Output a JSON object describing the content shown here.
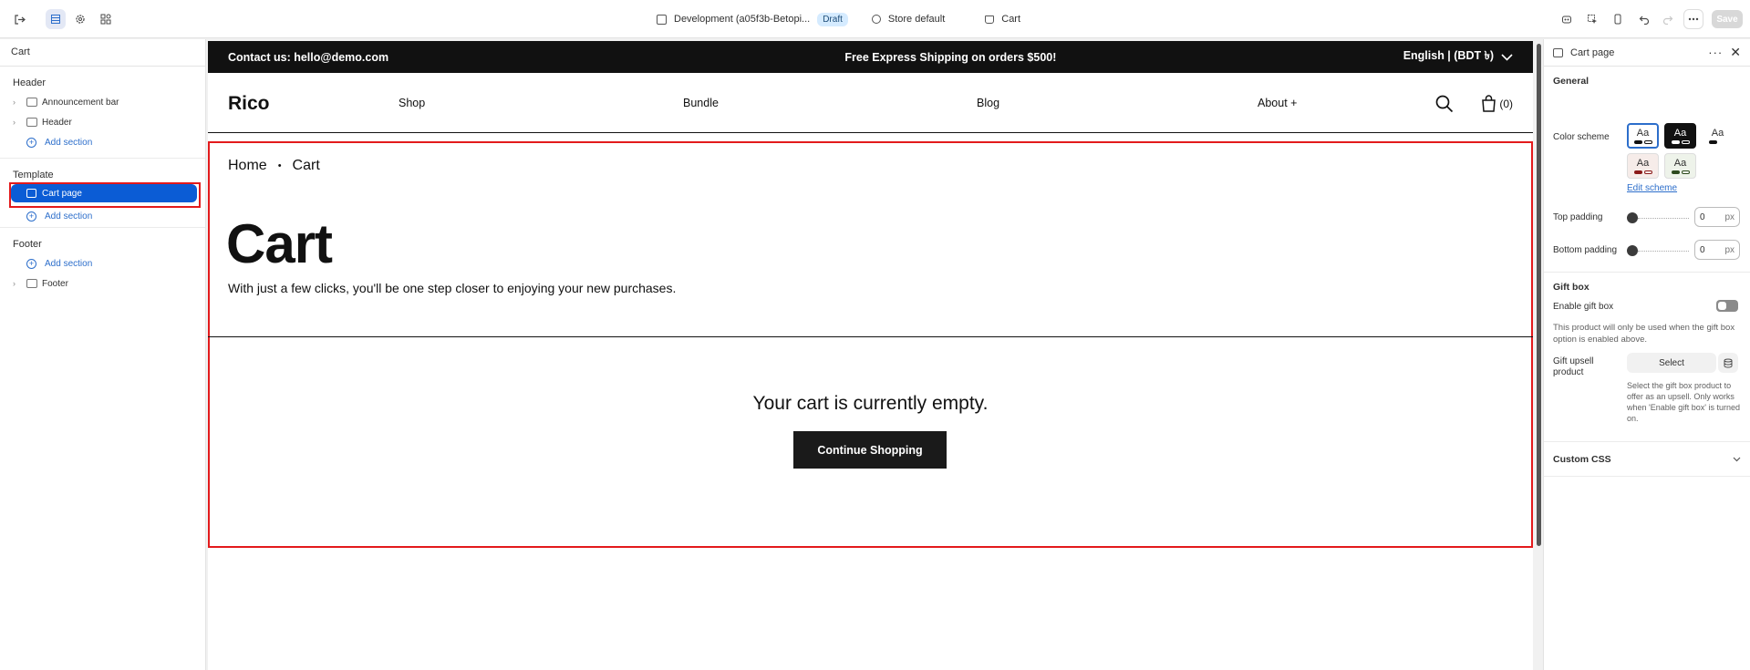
{
  "topbar": {
    "store_label": "Development (a05f3b-Betopi...",
    "draft_badge": "Draft",
    "theme_label": "Store default",
    "page_label": "Cart",
    "save_label": "Save"
  },
  "left_panel": {
    "title": "Cart",
    "header_group": "Header",
    "header_items": [
      "Announcement bar",
      "Header"
    ],
    "add_section": "Add section",
    "template_group": "Template",
    "template_selected": "Cart page",
    "footer_group": "Footer",
    "footer_items": [
      "Footer"
    ]
  },
  "preview": {
    "announce_left": "Contact us: hello@demo.com",
    "announce_center": "Free Express Shipping on orders $500!",
    "announce_right": "English | (BDT ৳)",
    "logo": "Rico",
    "nav": [
      "Shop",
      "Bundle",
      "Blog",
      "About +"
    ],
    "cart_count": "(0)",
    "crumb_home": "Home",
    "crumb_sep": "•",
    "crumb_current": "Cart",
    "heading": "Cart",
    "subheading": "With just a few clicks, you'll be one step closer to enjoying your new purchases.",
    "empty_message": "Your cart is currently empty.",
    "continue_button": "Continue Shopping"
  },
  "right_panel": {
    "title": "Cart page",
    "general": "General",
    "color_scheme_label": "Color scheme",
    "swatch_text": "Aa",
    "edit_scheme": "Edit scheme",
    "top_padding_label": "Top padding",
    "top_padding_value": "0",
    "bottom_padding_label": "Bottom padding",
    "bottom_padding_value": "0",
    "unit": "px",
    "gift_box": "Gift box",
    "enable_gift_box": "Enable gift box",
    "gift_note": "This product will only be used when the gift box option is enabled above.",
    "gift_upsell_label": "Gift upsell product",
    "select_label": "Select",
    "upsell_help": "Select the gift box product to offer as an upsell. Only works when 'Enable gift box' is turned on.",
    "custom_css": "Custom CSS"
  },
  "colors": {
    "accent": "#0b5cd5",
    "highlight": "#e31a1c"
  }
}
